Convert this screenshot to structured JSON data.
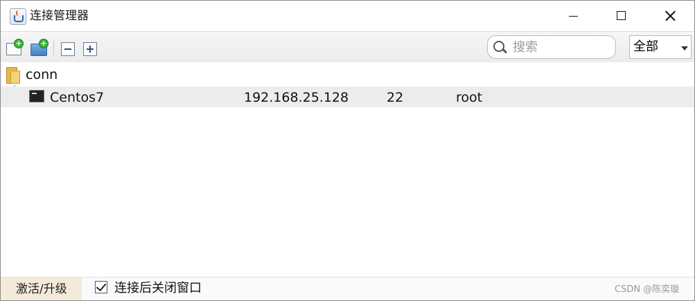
{
  "window": {
    "title": "连接管理器",
    "app_icon": "java-cup-icon"
  },
  "titlebar_controls": {
    "minimize_icon": "minimize-icon",
    "maximize_icon": "maximize-icon",
    "close_icon": "close-icon"
  },
  "toolbar": {
    "buttons": [
      {
        "name": "new-connection",
        "icon": "new-connection-icon"
      },
      {
        "name": "new-folder",
        "icon": "new-folder-icon"
      },
      {
        "name": "collapse-all",
        "icon": "collapse-icon"
      },
      {
        "name": "expand-all",
        "icon": "expand-icon"
      }
    ],
    "search": {
      "placeholder": "搜索",
      "value": ""
    },
    "scope": {
      "selected": "全部"
    }
  },
  "tree": {
    "folder": {
      "label": "conn",
      "icon": "folder-icon"
    },
    "connections": [
      {
        "name": "Centos7",
        "host": "192.168.25.128",
        "port": "22",
        "user": "root",
        "icon": "terminal-icon"
      }
    ]
  },
  "statusbar": {
    "activate_label": "激活/升级",
    "close_after_connect": {
      "label": "连接后关闭窗口",
      "checked": true
    },
    "watermark": "CSDN @陈奕璇"
  },
  "colors": {
    "selected_row": "#ececec",
    "activate_bg": "#f4ead9",
    "toolbar_bg": "#efefef"
  }
}
